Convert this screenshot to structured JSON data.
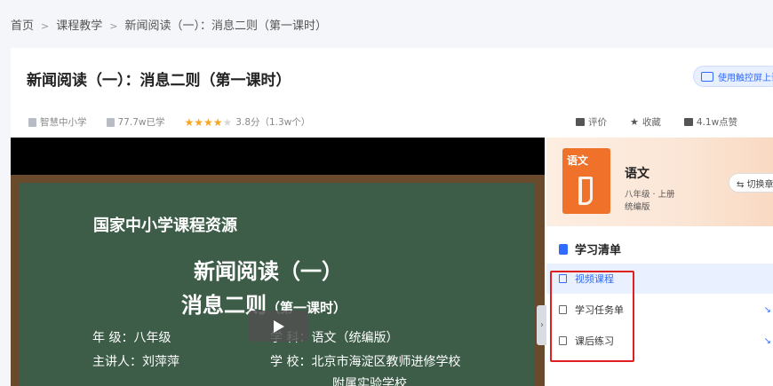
{
  "breadcrumb": [
    "首页",
    "课程教学",
    "新闻阅读（一）：消息二则（第一课时）"
  ],
  "title": "新闻阅读（一）：消息二则（第一课时）",
  "whiteboard_button": "使用触控屏上课",
  "meta": {
    "source": "智慧中小学",
    "views": "77.7w已学",
    "rating": 3.8,
    "rating_text": "3.8分（1.3w个）"
  },
  "actions": {
    "comment": "评价",
    "favorite": "收藏",
    "likes": "4.1w点赞"
  },
  "board": {
    "org": "国家中小学课程资源",
    "title1": "新闻阅读（一）",
    "title2": "消息二则",
    "title2_sub": "（第一课时）",
    "grade_line": "年  级：八年级",
    "subject_line": "学  科：语文（统编版）",
    "speaker_line": "主讲人：刘萍萍",
    "school_line": "学  校：北京市海淀区教师进修学校",
    "school_line2": "附属实验学校"
  },
  "subject": {
    "cover_label": "语文",
    "name": "语文",
    "grade": "八年级 · 上册",
    "edition": "统编版",
    "switch_label": "⇆ 切换章节"
  },
  "study_list": {
    "heading": "学习清单",
    "items": [
      {
        "label": "视频课程",
        "active": true
      },
      {
        "label": "学习任务单",
        "active": false
      },
      {
        "label": "课后练习",
        "active": false
      }
    ]
  },
  "colors": {
    "accent": "#2f6bff",
    "highlight": "#e02020",
    "cover": "#f0712a",
    "board": "#3d5d48"
  }
}
